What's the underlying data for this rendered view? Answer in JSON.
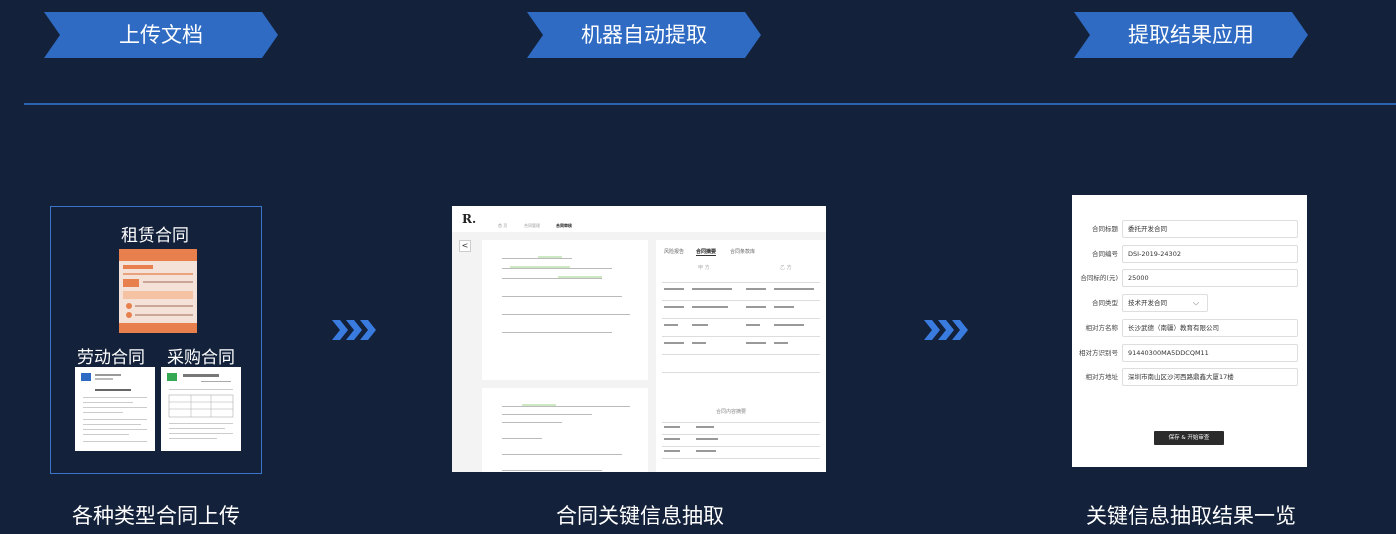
{
  "steps": [
    {
      "label": "上传文档"
    },
    {
      "label": "机器自动提取"
    },
    {
      "label": "提取结果应用"
    }
  ],
  "captions": [
    "各种类型合同上传",
    "合同关键信息抽取",
    "关键信息抽取结果一览"
  ],
  "colors": {
    "background": "#13213b",
    "tag": "#2f6bc2",
    "divider": "#2a63b0",
    "arrow": "#3a7be0"
  },
  "upload": {
    "lease_label": "租赁合同",
    "labor_label": "劳动合同",
    "purchase_label": "采购合同"
  },
  "extract": {
    "logo": "R.",
    "nav": [
      "首 页",
      "合同管理",
      "合同审核"
    ],
    "back_icon": "<",
    "tabs": [
      "风险报告",
      "合同摘要",
      "合同条款库"
    ],
    "parties": [
      "甲 方",
      "乙 方"
    ],
    "section_title": "合同内容摘要"
  },
  "result": {
    "fields": [
      {
        "label": "合同标题",
        "value": "委托开发合同"
      },
      {
        "label": "合同编号",
        "value": "DSI-2019-24302"
      },
      {
        "label": "合同标的(元)",
        "value": "25000"
      },
      {
        "label": "合同类型",
        "value": "技术开发合同"
      },
      {
        "label": "相对方名称",
        "value": "长沙武德（南疆）教育有限公司"
      },
      {
        "label": "相对方识别号",
        "value": "91440300MA5DDCQM11"
      },
      {
        "label": "相对方地址",
        "value": "深圳市南山区沙河西路鼎鑫大厦17楼"
      }
    ],
    "save_button": "保存 & 开始审查",
    "select_chevron_icon": "chevron-down-icon"
  }
}
